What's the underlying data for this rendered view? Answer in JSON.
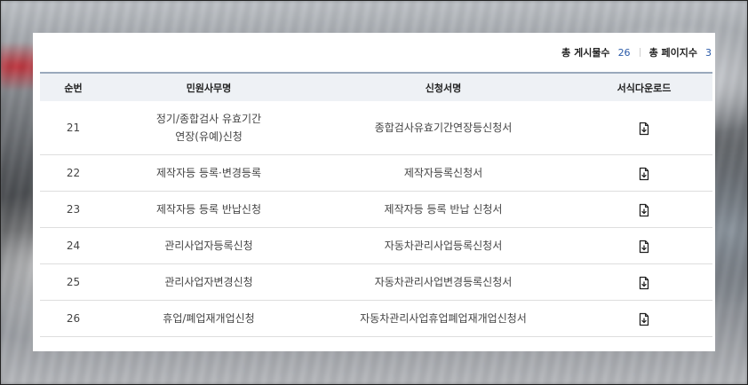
{
  "summary": {
    "total_posts_label": "총 게시물수",
    "total_posts": "26",
    "total_pages_label": "총 페이지수",
    "total_pages": "3"
  },
  "table": {
    "headers": [
      "순번",
      "민원사무명",
      "신청서명",
      "서식다운로드"
    ],
    "rows": [
      {
        "no": "21",
        "name_line1": "정기/종합검사 유효기간",
        "name_line2": "연장(유예)신청",
        "form": "종합검사유효기간연장등신청서"
      },
      {
        "no": "22",
        "name_line1": "제작자등 등록·변경등록",
        "name_line2": "",
        "form": "제작자등록신청서"
      },
      {
        "no": "23",
        "name_line1": "제작자등 등록 반납신청",
        "name_line2": "",
        "form": "제작자등 등록 반납 신청서"
      },
      {
        "no": "24",
        "name_line1": "관리사업자등록신청",
        "name_line2": "",
        "form": "자동차관리사업등록신청서"
      },
      {
        "no": "25",
        "name_line1": "관리사업자변경신청",
        "name_line2": "",
        "form": "자동차관리사업변경등록신청서"
      },
      {
        "no": "26",
        "name_line1": "휴업/폐업재개업신청",
        "name_line2": "",
        "form": "자동차관리사업휴업폐업재개업신청서"
      }
    ]
  },
  "icons": {
    "download": "file-download-icon"
  }
}
